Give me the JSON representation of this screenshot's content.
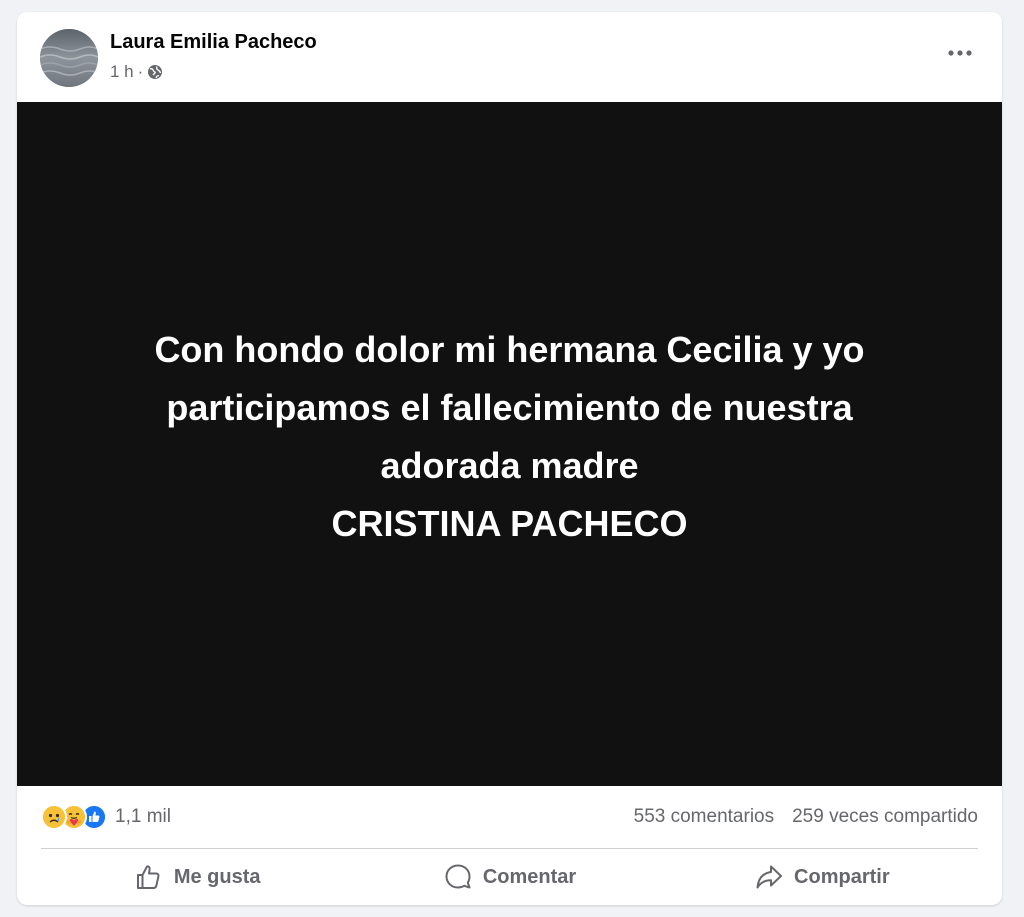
{
  "post": {
    "author": "Laura Emilia Pacheco",
    "time": "1 h",
    "separator": "·",
    "audience_icon": "globe-icon",
    "menu_icon": "more-options-icon"
  },
  "image_text": {
    "line1": "Con hondo dolor mi hermana Cecilia y yo",
    "line2": "participamos el fallecimiento de nuestra",
    "line3": "adorada madre",
    "line4": "CRISTINA PACHECO"
  },
  "stats": {
    "reactions": [
      "sad-reaction-icon",
      "care-reaction-icon",
      "like-reaction-icon"
    ],
    "reaction_count": "1,1 mil",
    "comments": "553 comentarios",
    "shares": "259 veces compartido"
  },
  "actions": {
    "like": "Me gusta",
    "comment": "Comentar",
    "share": "Compartir"
  },
  "colors": {
    "background": "#f0f2f5",
    "card": "#ffffff",
    "image_bg": "#111112",
    "secondary_text": "#65676b",
    "like_blue": "#1877f2"
  }
}
